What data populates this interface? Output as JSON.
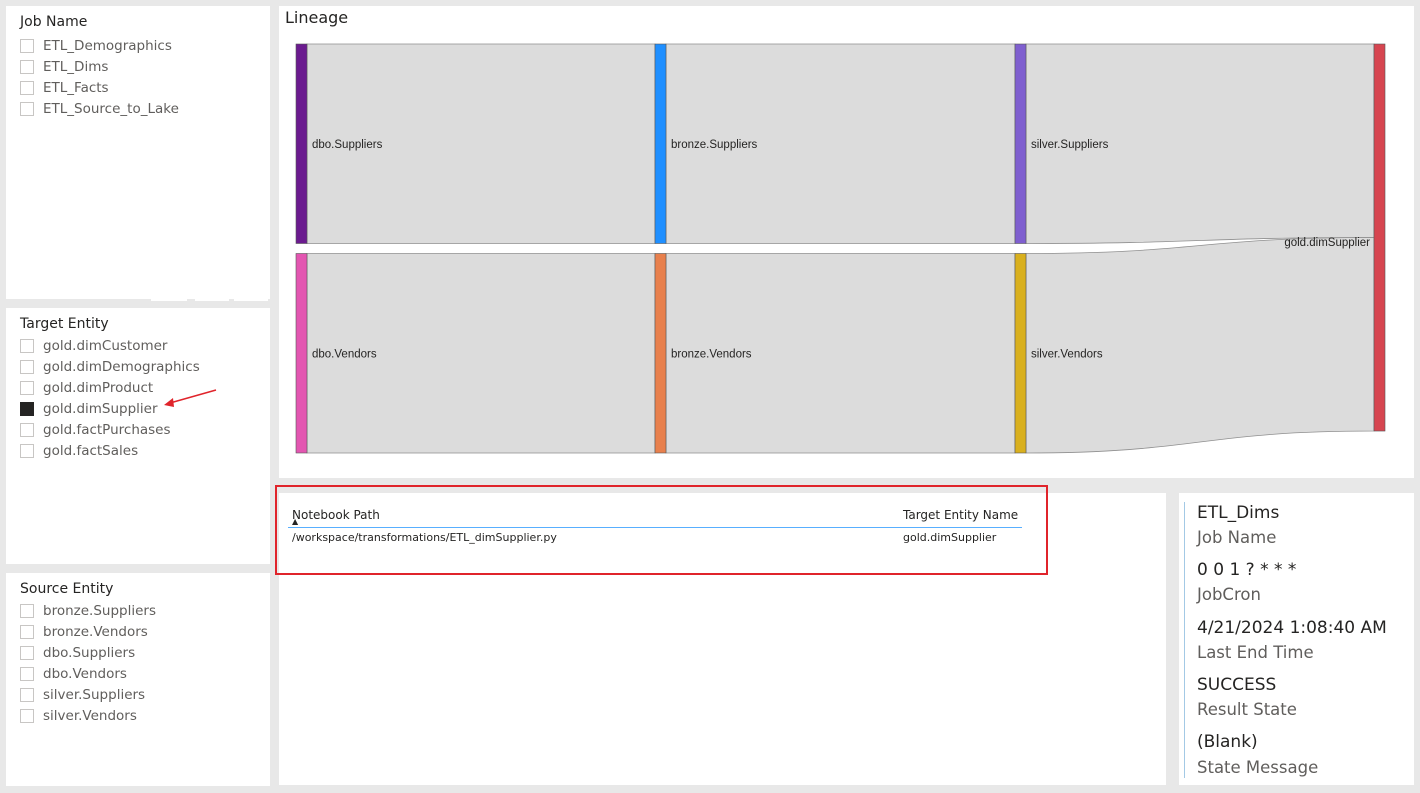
{
  "job_slicer": {
    "title": "Job Name",
    "items": [
      {
        "label": "ETL_Demographics",
        "checked": false
      },
      {
        "label": "ETL_Dims",
        "checked": false
      },
      {
        "label": "ETL_Facts",
        "checked": false
      },
      {
        "label": "ETL_Source_to_Lake",
        "checked": false
      }
    ]
  },
  "target_slicer": {
    "title": "Target Entity",
    "items": [
      {
        "label": "gold.dimCustomer",
        "checked": false
      },
      {
        "label": "gold.dimDemographics",
        "checked": false
      },
      {
        "label": "gold.dimProduct",
        "checked": false
      },
      {
        "label": "gold.dimSupplier",
        "checked": true
      },
      {
        "label": "gold.factPurchases",
        "checked": false
      },
      {
        "label": "gold.factSales",
        "checked": false
      }
    ]
  },
  "source_slicer": {
    "title": "Source Entity",
    "items": [
      {
        "label": "bronze.Suppliers",
        "checked": false
      },
      {
        "label": "bronze.Vendors",
        "checked": false
      },
      {
        "label": "dbo.Suppliers",
        "checked": false
      },
      {
        "label": "dbo.Vendors",
        "checked": false
      },
      {
        "label": "silver.Suppliers",
        "checked": false
      },
      {
        "label": "silver.Vendors",
        "checked": false
      }
    ]
  },
  "lineage": {
    "title": "Lineage",
    "colors": {
      "dbo.Suppliers": "#6b1b8f",
      "dbo.Vendors": "#e356b1",
      "bronze.Suppliers": "#1f8fff",
      "bronze.Vendors": "#e8804d",
      "silver.Suppliers": "#7f5fcf",
      "silver.Vendors": "#d9b01e",
      "gold.dimSupplier": "#d64550",
      "link": "#dcdcdc",
      "link_stroke": "#8f8f8f"
    },
    "stages": [
      [
        "dbo.Suppliers",
        "dbo.Vendors"
      ],
      [
        "bronze.Suppliers",
        "bronze.Vendors"
      ],
      [
        "silver.Suppliers",
        "silver.Vendors"
      ],
      [
        "gold.dimSupplier"
      ]
    ],
    "links": [
      {
        "source": "dbo.Suppliers",
        "target": "bronze.Suppliers",
        "value": 1
      },
      {
        "source": "dbo.Vendors",
        "target": "bronze.Vendors",
        "value": 1
      },
      {
        "source": "bronze.Suppliers",
        "target": "silver.Suppliers",
        "value": 1
      },
      {
        "source": "bronze.Vendors",
        "target": "silver.Vendors",
        "value": 1
      },
      {
        "source": "silver.Suppliers",
        "target": "gold.dimSupplier",
        "value": 1
      },
      {
        "source": "silver.Vendors",
        "target": "gold.dimSupplier",
        "value": 1
      }
    ]
  },
  "table": {
    "headers": [
      "Notebook Path",
      "Target Entity Name"
    ],
    "rows": [
      [
        "/workspace/transformations/ETL_dimSupplier.py",
        "gold.dimSupplier"
      ]
    ],
    "sort_indicator": "▲"
  },
  "card": {
    "fields": [
      {
        "value": "ETL_Dims",
        "label": "Job Name"
      },
      {
        "value": "0 0 1 ? * * *",
        "label": "JobCron"
      },
      {
        "value": "4/21/2024 1:08:40 AM",
        "label": "Last End Time"
      },
      {
        "value": "SUCCESS",
        "label": "Result State"
      },
      {
        "value": "(Blank)",
        "label": "State Message"
      }
    ]
  },
  "annotation": {
    "arrow_color": "#e0242b",
    "focus_border_color": "#e0242b"
  }
}
